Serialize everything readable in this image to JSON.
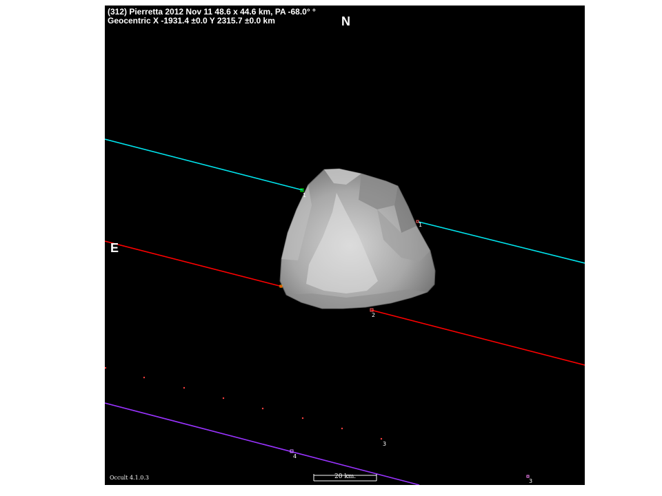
{
  "header": {
    "line1": "(312) Pierretta  2012 Nov 11  48.6 x 44.6 km, PA -68.0° °",
    "line2": "Geocentric  X  -1931.4 ±0.0  Y 2315.7 ±0.0 km"
  },
  "compass": {
    "north": "N",
    "east": "E"
  },
  "footer": {
    "version": "Occult 4.1.0.3",
    "scale": "20 km."
  },
  "chords": [
    {
      "id": "1",
      "color": "#00ffff",
      "type": "positive"
    },
    {
      "id": "2",
      "color": "#ff0000",
      "type": "positive"
    },
    {
      "id": "3",
      "color": "#ff4040",
      "type": "miss"
    },
    {
      "id": "4",
      "color": "#9933ff",
      "type": "miss"
    }
  ],
  "chord_labels": [
    "1",
    "1",
    "2",
    "3",
    "4",
    "3"
  ],
  "colors": {
    "background": "#000000",
    "asteroid": "#b4b4b4"
  }
}
